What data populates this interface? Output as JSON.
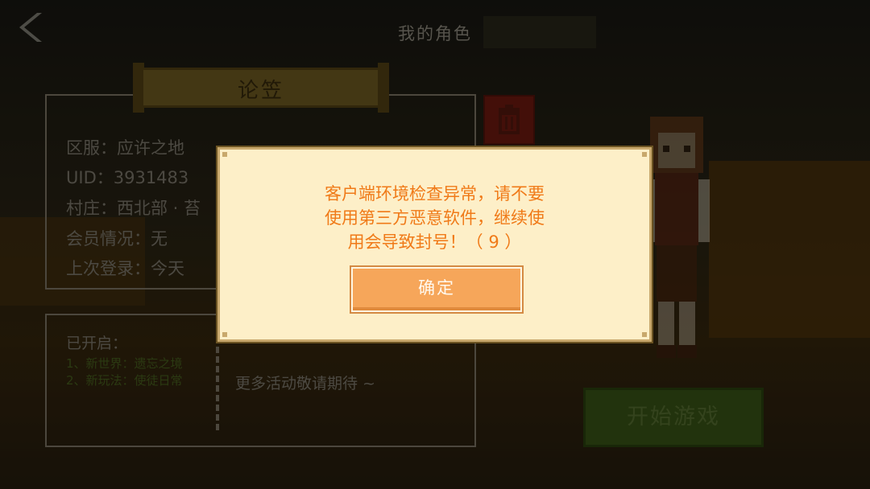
{
  "header": {
    "title": "我的角色"
  },
  "character": {
    "name": "论笠",
    "info": [
      "区服：应许之地",
      "UID：3931483",
      "村庄：西北部 · 苔",
      "会员情况：无",
      "上次登录：今天"
    ]
  },
  "events": {
    "open_label": "已开启：",
    "items": [
      "1、新世界：遗忘之境",
      "2、新玩法：使徒日常"
    ],
    "more": "更多活动敬请期待 ~"
  },
  "start_button": {
    "label": "开始游戏"
  },
  "dialog": {
    "message_lines": [
      "客户端环境检查异常，请不要",
      "使用第三方恶意软件，继续使",
      "用会导致封号！（ 9 ）"
    ],
    "confirm_label": "确定"
  },
  "colors": {
    "dialog_text": "#f07a18",
    "confirm_button": "#f6a65a",
    "start_button": "#3f5e18"
  }
}
